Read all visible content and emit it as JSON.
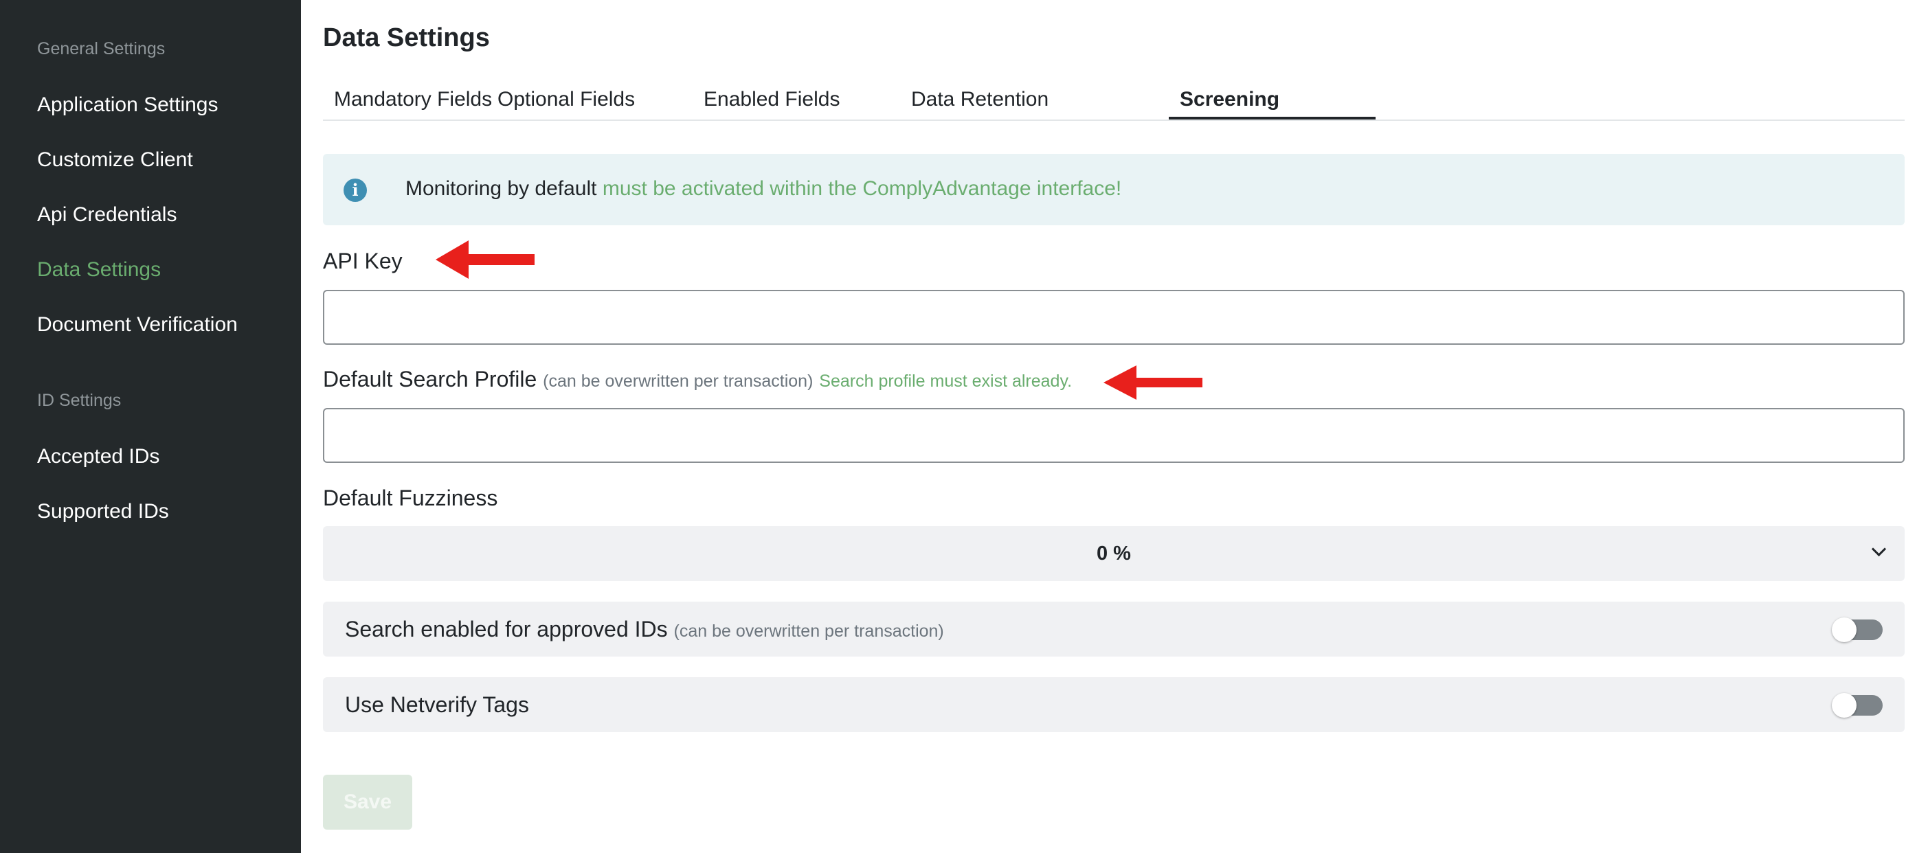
{
  "sidebar": {
    "sections": [
      {
        "title": "General Settings",
        "items": [
          {
            "label": "Application Settings"
          },
          {
            "label": "Customize Client"
          },
          {
            "label": "Api Credentials"
          },
          {
            "label": "Data Settings"
          },
          {
            "label": "Document Verification"
          }
        ]
      },
      {
        "title": "ID Settings",
        "items": [
          {
            "label": "Accepted IDs"
          },
          {
            "label": "Supported IDs"
          }
        ]
      }
    ]
  },
  "main": {
    "title": "Data Settings",
    "tabs": [
      {
        "label": "Mandatory Fields"
      },
      {
        "label": "Optional Fields"
      },
      {
        "label": "Enabled Fields"
      },
      {
        "label": "Data Retention"
      },
      {
        "label": "Screening"
      }
    ],
    "active_tab": "Screening",
    "alert": {
      "icon": "info-icon",
      "text_prefix": "Monitoring by default ",
      "text_highlight": "must be activated within the ComplyAdvantage interface!"
    },
    "api_key": {
      "label": "API Key",
      "value": ""
    },
    "search_profile": {
      "label": "Default Search Profile",
      "hint": "(can be overwritten per transaction)",
      "note": "Search profile must exist already.",
      "value": ""
    },
    "fuzziness": {
      "label": "Default Fuzziness",
      "value": "0 %"
    },
    "toggles": [
      {
        "label": "Search enabled for approved IDs",
        "hint": "(can be overwritten per transaction)",
        "enabled": false
      },
      {
        "label": "Use Netverify Tags",
        "hint": "",
        "enabled": false
      }
    ],
    "save_label": "Save"
  },
  "colors": {
    "sidebar_bg": "#24292b",
    "accent_green": "#6aad6f",
    "alert_bg": "#e9f3f5",
    "annotation_arrow": "#e8201c"
  }
}
